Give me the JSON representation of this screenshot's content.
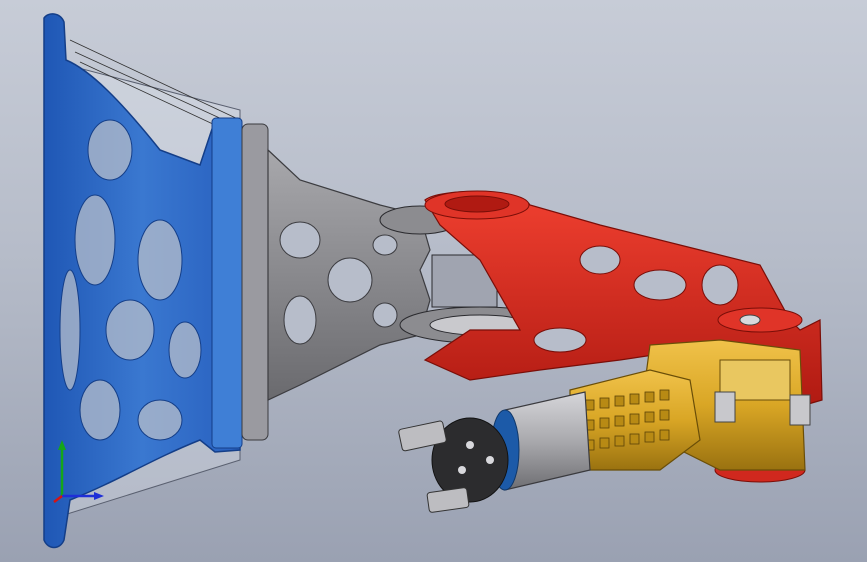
{
  "viewport": {
    "background_top": "#c7ccd7",
    "background_bottom": "#9aa1b2"
  },
  "parts": {
    "base_mount": {
      "color": "#3a78d0"
    },
    "transparent_housing": {
      "color": "#dfe4ee"
    },
    "upper_arm": {
      "color": "#8a8a8e"
    },
    "forearm": {
      "color": "#e0261e"
    },
    "wrist": {
      "color": "#d9a625"
    },
    "gripper_motor": {
      "color": "#a9a9ad"
    },
    "gripper_jaws": {
      "color": "#2c2c2e"
    }
  },
  "triad": {
    "x_color": "#1f2fd8",
    "y_color": "#15a51a",
    "z_color": "#d41414"
  }
}
